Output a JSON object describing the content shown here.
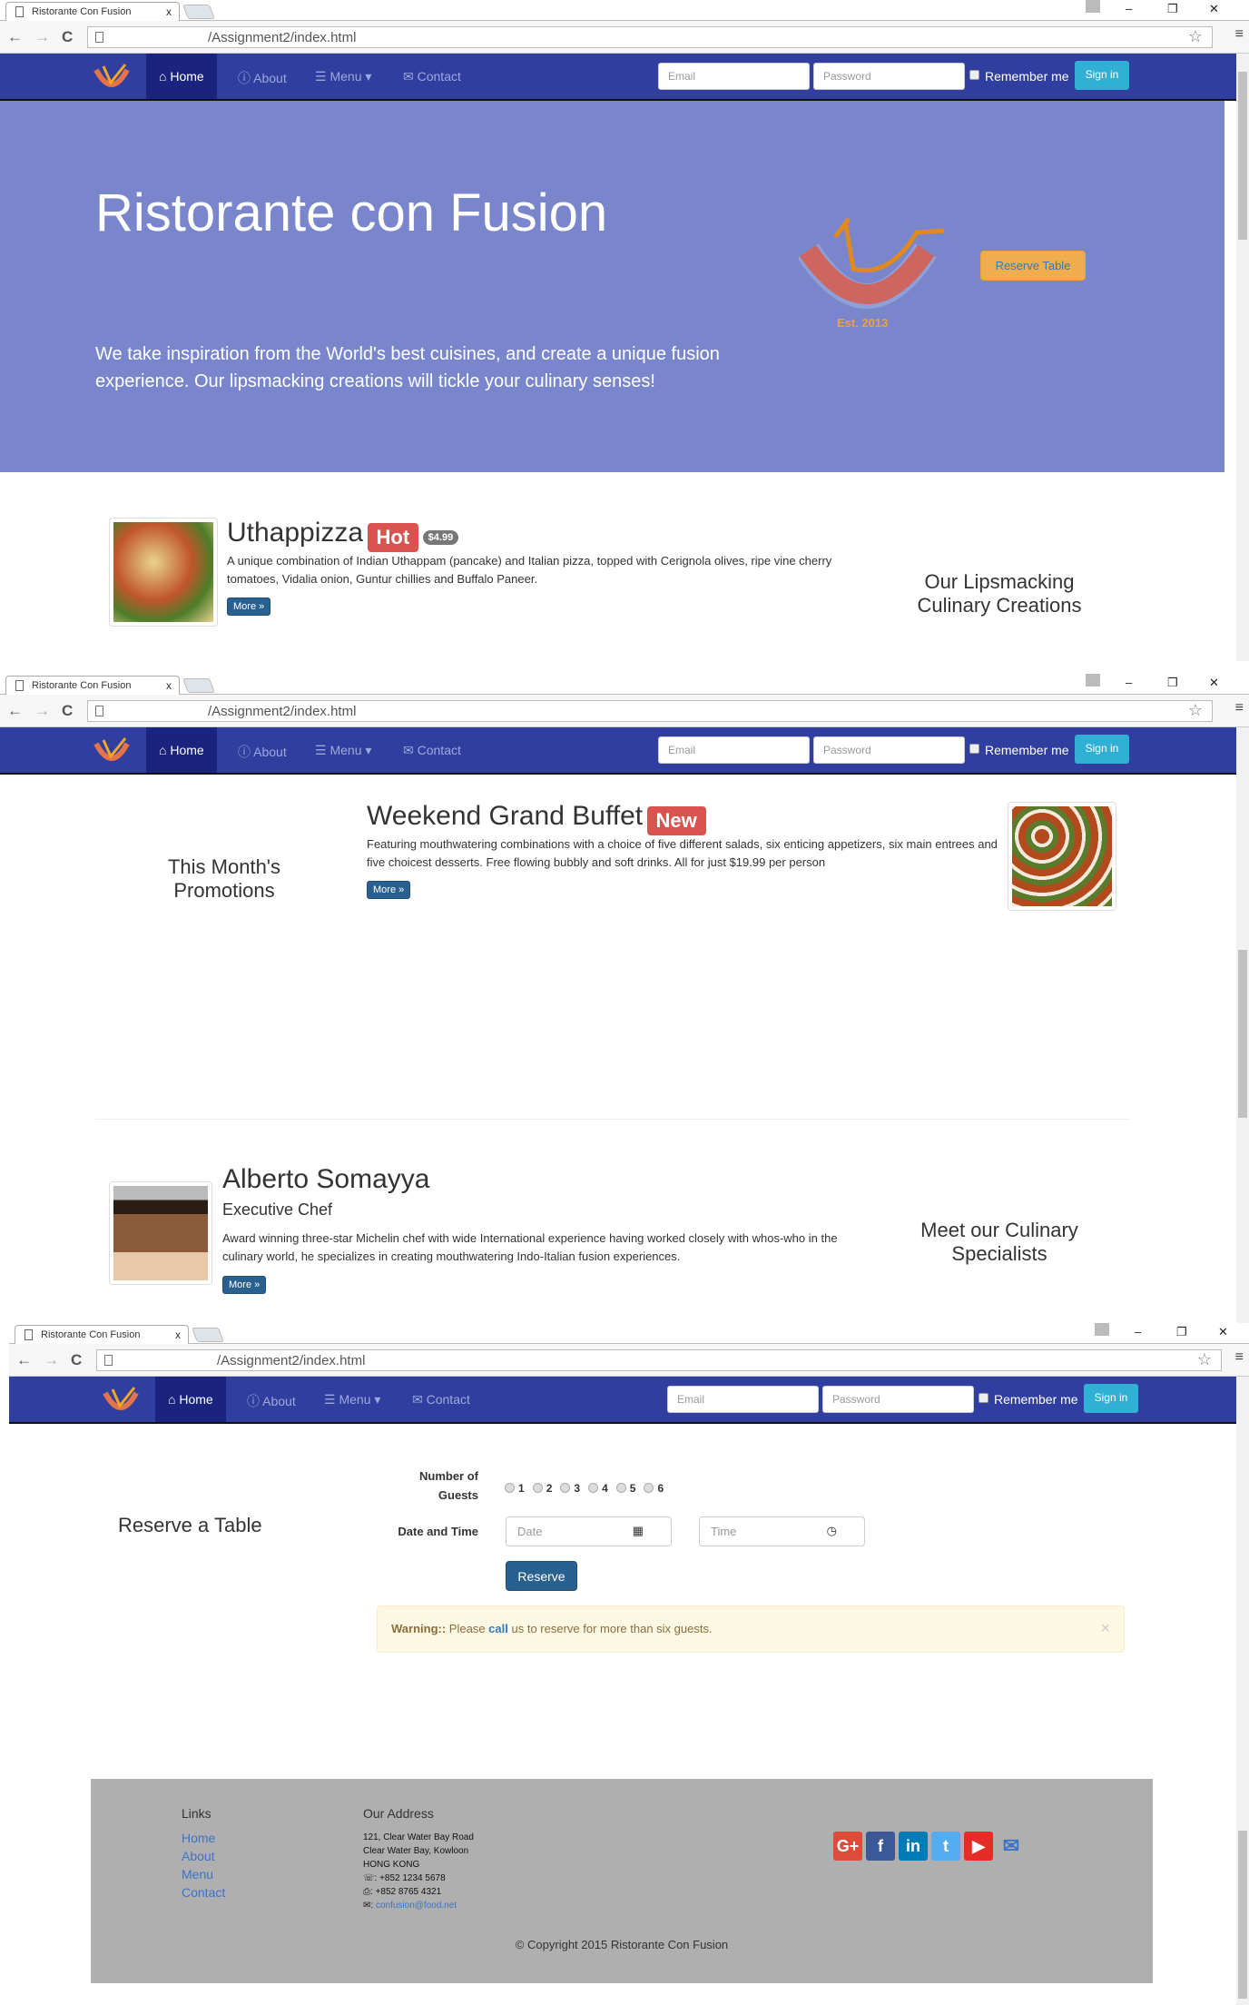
{
  "browser": {
    "tab_title": "Ristorante Con Fusion",
    "tab_close": "x",
    "url": "/Assignment2/index.html",
    "back": "←",
    "forward": "→",
    "reload": "C",
    "minimize": "–",
    "restore": "❐",
    "close": "✕"
  },
  "nav": {
    "items": [
      {
        "label": "Home",
        "icon": "home-icon",
        "glyph": "⌂"
      },
      {
        "label": "About",
        "icon": "info-icon",
        "glyph": "ⓘ"
      },
      {
        "label": "Menu",
        "icon": "list-icon",
        "glyph": "☰"
      },
      {
        "label": "Contact",
        "icon": "envelope-icon",
        "glyph": "✉"
      }
    ],
    "menu_caret": "▾",
    "email_placeholder": "Email",
    "password_placeholder": "Password",
    "remember_me": "Remember me",
    "sign_in": "Sign in"
  },
  "jumbotron": {
    "title": "Ristorante con Fusion",
    "text": "We take inspiration from the World's best cuisines, and create a unique fusion experience. Our lipsmacking creations will tickle your culinary senses!",
    "logo_text": "Ristorante con Fusion",
    "logo_est": "Est. 2013",
    "reserve_button": "Reserve Table"
  },
  "dish": {
    "name": "Uthappizza",
    "badge": "Hot",
    "price": "$4.99",
    "description": "A unique combination of Indian Uthappam (pancake) and Italian pizza, topped with Cerignola olives, ripe vine cherry tomatoes, Vidalia onion, Guntur chillies and Buffalo Paneer.",
    "more": "More »",
    "section_title": "Our Lipsmacking Culinary Creations"
  },
  "promotion": {
    "name": "Weekend Grand Buffet",
    "badge": "New",
    "description": "Featuring mouthwatering combinations with a choice of five different salads, six enticing appetizers, six main entrees and five choicest desserts. Free flowing bubbly and soft drinks. All for just $19.99 per person",
    "more": "More »",
    "section_title": "This Month's Promotions"
  },
  "leader": {
    "name": "Alberto Somayya",
    "role": "Executive Chef",
    "description": "Award winning three-star Michelin chef with wide International experience having worked closely with whos-who in the culinary world, he specializes in creating mouthwatering Indo-Italian fusion experiences.",
    "more": "More »",
    "section_title": "Meet our Culinary Specialists"
  },
  "reservation": {
    "section_title": "Reserve a Table",
    "guests_label": "Number of Guests",
    "guest_options": [
      "1",
      "2",
      "3",
      "4",
      "5",
      "6"
    ],
    "datetime_label": "Date and Time",
    "date_placeholder": "Date",
    "time_placeholder": "Time",
    "reserve_button": "Reserve",
    "alert_strong": "Warning::",
    "alert_pre": "Please",
    "alert_link": "call",
    "alert_post": "us to reserve for more than six guests.",
    "alert_close": "×"
  },
  "footer": {
    "links_title": "Links",
    "links": [
      "Home",
      "About",
      "Menu",
      "Contact"
    ],
    "address_title": "Our Address",
    "address_lines": [
      "121, Clear Water Bay Road",
      "Clear Water Bay, Kowloon",
      "HONG KONG"
    ],
    "phone": ": +852 1234 5678",
    "fax": ": +852 8765 4321",
    "email": "confusion@food.net",
    "social": [
      {
        "name": "google-plus",
        "glyph": "G+",
        "color": "#dd4b39"
      },
      {
        "name": "facebook",
        "glyph": "f",
        "color": "#3b5998"
      },
      {
        "name": "linkedin",
        "glyph": "in",
        "color": "#007bb6"
      },
      {
        "name": "twitter",
        "glyph": "t",
        "color": "#55acee"
      },
      {
        "name": "youtube",
        "glyph": "▶",
        "color": "#e52d27"
      }
    ],
    "copyright": "© Copyright 2015 Ristorante Con Fusion"
  },
  "colors": {
    "nav": "#303f9f",
    "jumbotron": "#7986cb",
    "footer": "#afafaf",
    "primary": "#286090",
    "warning": "#f0ad4e"
  }
}
